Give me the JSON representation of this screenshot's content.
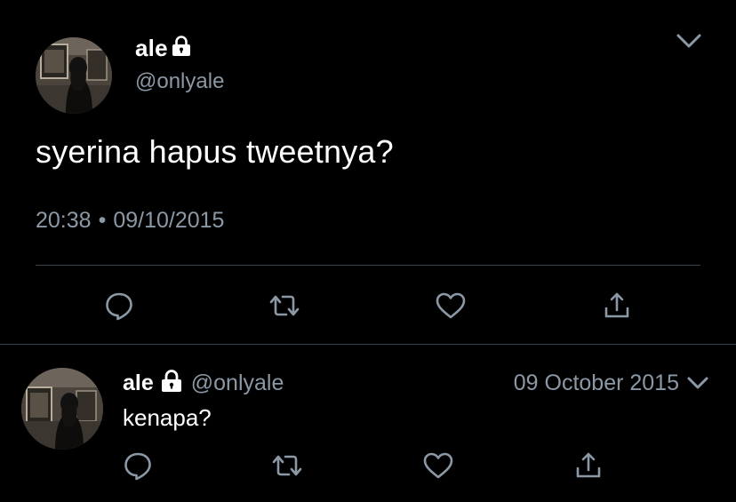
{
  "main_tweet": {
    "display_name": "ale",
    "handle": "@onlyale",
    "text": "syerina hapus tweetnya?",
    "time": "20:38",
    "separator": "•",
    "date": "09/10/2015",
    "icons": {
      "lock": "lock-icon",
      "menu": "chevron-down-icon",
      "reply": "reply-icon",
      "retweet": "retweet-icon",
      "like": "heart-icon",
      "share": "share-icon"
    }
  },
  "reply_tweet": {
    "display_name": "ale",
    "handle": "@onlyale",
    "date": "09 October 2015",
    "text": "kenapa?"
  },
  "colors": {
    "background": "#000000",
    "primary_text": "#ffffff",
    "secondary_text": "#8b98a5",
    "divider": "#38444d"
  }
}
